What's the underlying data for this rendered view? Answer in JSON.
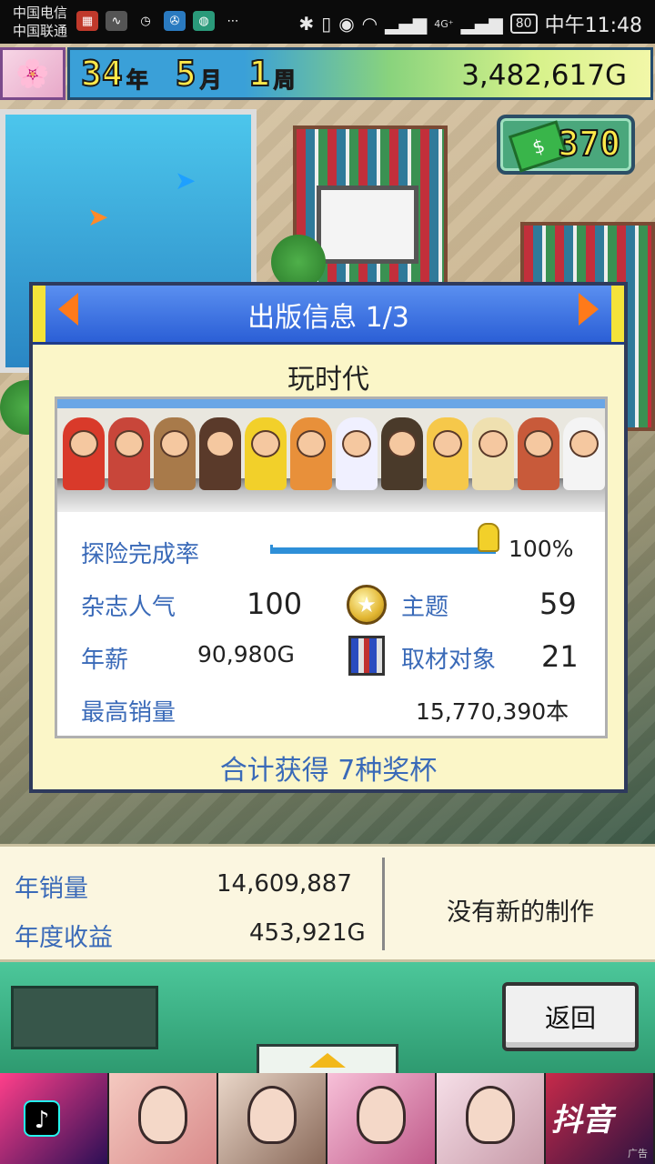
{
  "statusbar": {
    "carrier1": "中国电信",
    "carrier2": "中国联通",
    "network": "4G⁺",
    "battery": "80",
    "time": "中午11:48"
  },
  "hud": {
    "year_num": "34",
    "year_unit": "年",
    "month_num": "5",
    "month_unit": "月",
    "week_num": "1",
    "week_unit": "周",
    "money": "3,482,617G",
    "badge_value": "370"
  },
  "dialog": {
    "title": "出版信息 1/3",
    "subtitle": "玩时代",
    "rows": {
      "explore_label": "探险完成率",
      "explore_value": "100%",
      "explore_progress": 1.0,
      "popularity_label": "杂志人气",
      "popularity_value": "100",
      "theme_label": "主题",
      "theme_value": "59",
      "salary_label": "年薪",
      "salary_value": "90,980G",
      "subject_label": "取材对象",
      "subject_value": "21",
      "best_sales_label": "最高销量",
      "best_sales_value": "15,770,390本"
    },
    "trophies": "合计获得 7种奖杯",
    "cast_colors": [
      "#d93a2a",
      "#c8463a",
      "#a87a4a",
      "#5a3a2a",
      "#f2d02a",
      "#e8903a",
      "#f0f0ff",
      "#4a3a2a",
      "#f6c84a",
      "#efe0b0",
      "#c85a3a",
      "#f4f4f4"
    ]
  },
  "stats": {
    "annual_sales_label": "年销量",
    "annual_sales_value": "14,609,887",
    "annual_revenue_label": "年度收益",
    "annual_revenue_value": "453,921G",
    "status_text": "没有新的制作"
  },
  "controls": {
    "back_label": "返回"
  },
  "ad": {
    "brand": "抖音",
    "tag": "广告"
  }
}
